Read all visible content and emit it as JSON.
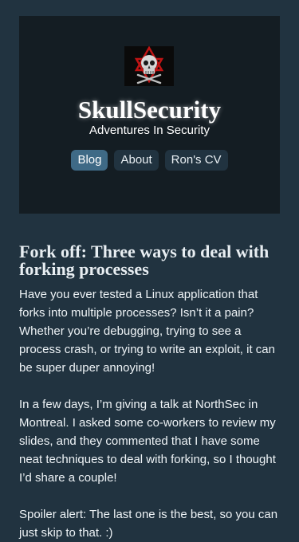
{
  "header": {
    "logo_icon": "skull-logo-icon",
    "site_title": "SkullSecurity",
    "tagline": "Adventures In Security",
    "nav": [
      {
        "label": "Blog",
        "active": true
      },
      {
        "label": "About",
        "active": false
      },
      {
        "label": "Ron's CV",
        "active": false
      }
    ]
  },
  "post": {
    "title": "Fork off: Three ways to deal with forking processes",
    "paragraphs": [
      "Have you ever tested a Linux application that forks into multiple processes? Isn’t it a pain? Whether you’re debugging, trying to see a process crash, or trying to write an exploit, it can be super duper annoying!",
      "In a few days, I’m giving a talk at NorthSec in Montreal. I asked some co-workers to review my slides, and they commented that I have some neat techniques to deal with forking, so I thought I’d share a couple!",
      "Spoiler alert: The last one is the best, so you can just skip to that. :)"
    ]
  },
  "colors": {
    "page_background": "#213340",
    "header_background": "#141d23",
    "nav_active": "#3f6a86",
    "nav_inactive": "#213340",
    "logo_red": "#d01818"
  }
}
